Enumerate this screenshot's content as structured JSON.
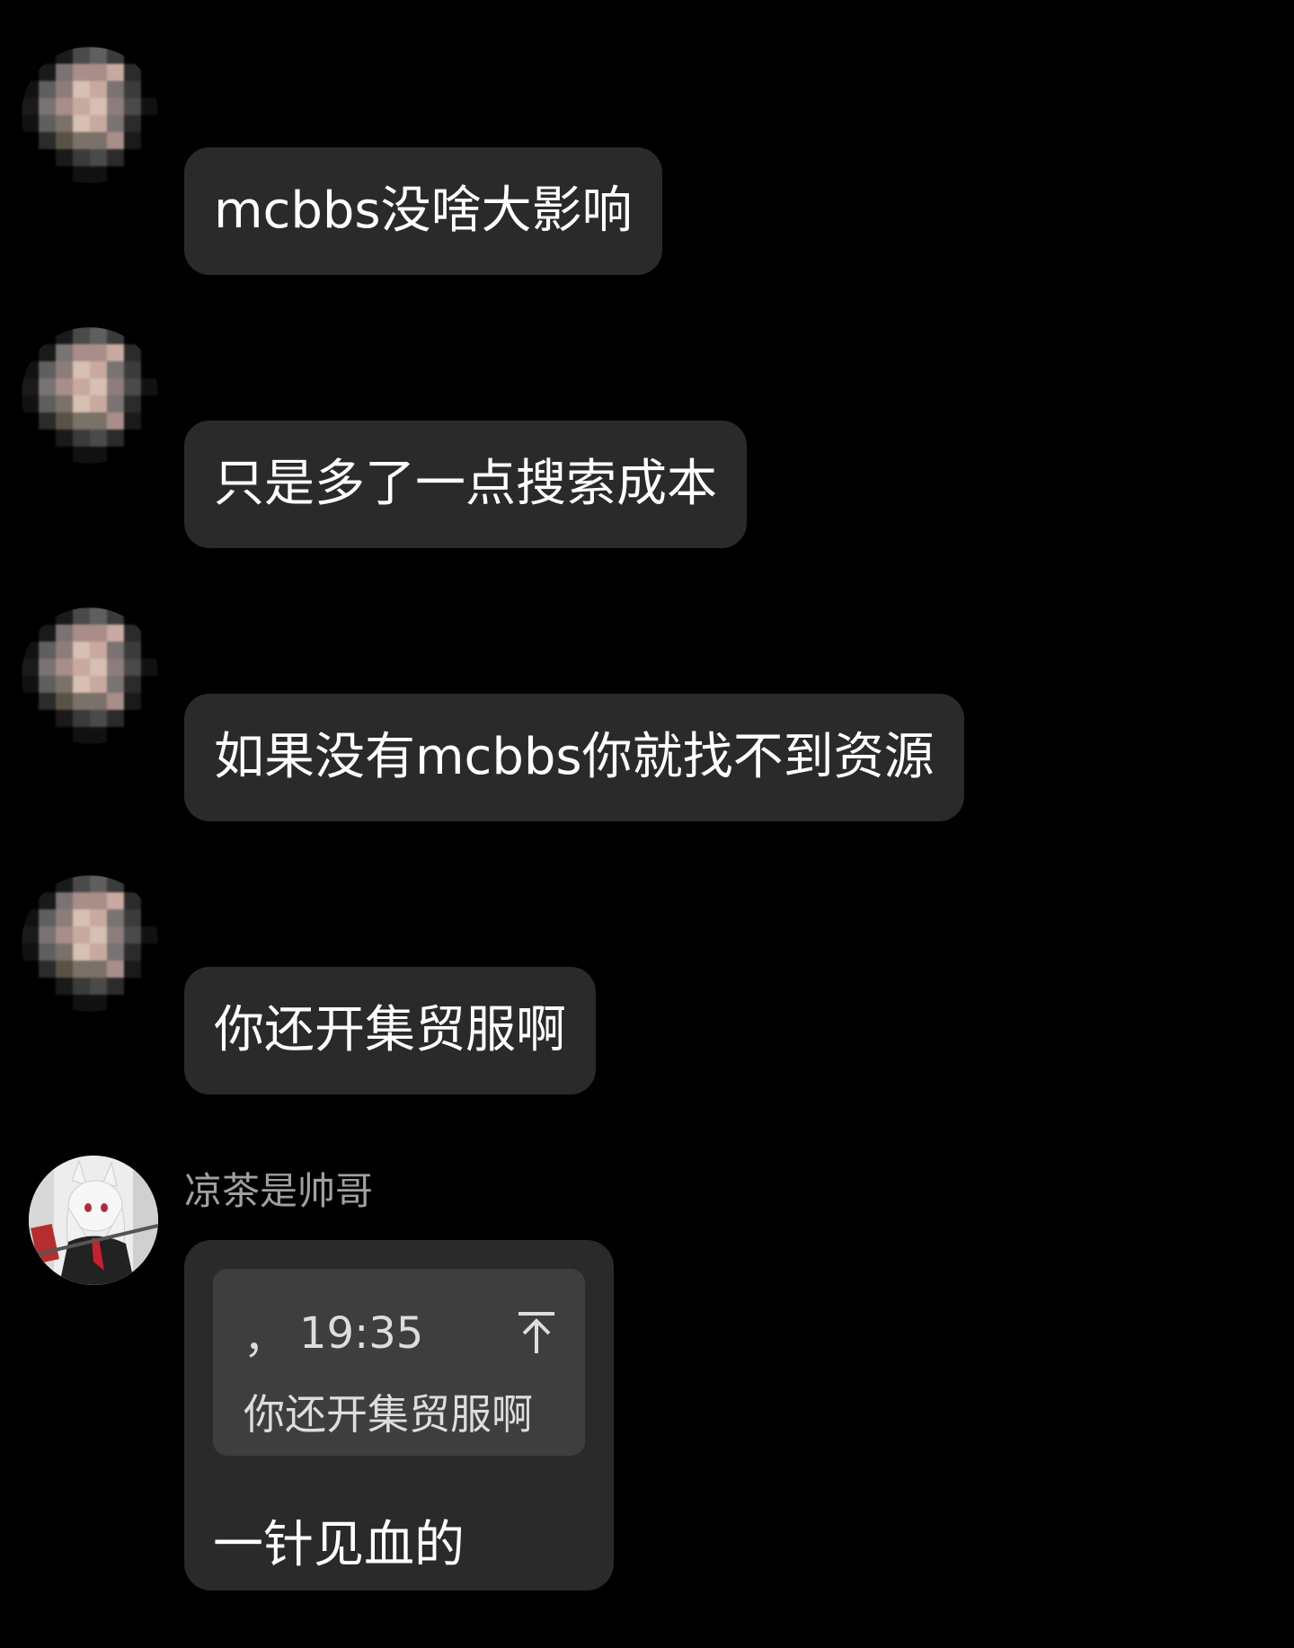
{
  "messages": [
    {
      "text": "mcbbs没啥大影响"
    },
    {
      "text": "只是多了一点搜索成本"
    },
    {
      "text": "如果没有mcbbs你就找不到资源"
    },
    {
      "text": "你还开集贸服啊"
    }
  ],
  "last_message": {
    "sender_name": "凉茶是帅哥",
    "quote": {
      "prefix": "，",
      "time": "19:35",
      "jump_icon": "arrow-up-to-top-icon",
      "text": "你还开集贸服啊"
    },
    "text": "一针见血的"
  },
  "colors": {
    "background": "#000000",
    "bubble": "#2a2a2a",
    "quote_box": "#3e3e3e",
    "sender_name": "#a0a0a0"
  }
}
